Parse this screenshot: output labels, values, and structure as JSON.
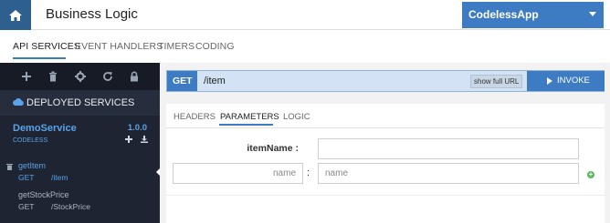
{
  "header": {
    "title": "Business Logic",
    "app_name": "CodelessApp"
  },
  "nav_tabs": [
    "API SERVICES",
    "EVENT HANDLERS",
    "TIMERS",
    "CODING"
  ],
  "sidebar": {
    "toolbar_icons": [
      "plus-icon",
      "trash-icon",
      "gear-icon",
      "refresh-icon",
      "lock-icon"
    ],
    "deployed_label": "DEPLOYED SERVICES",
    "service": {
      "name": "DemoService",
      "version": "1.0.0",
      "subtitle": "CODELESS"
    },
    "methods": [
      {
        "name": "getItem",
        "verb": "GET",
        "path": "/item"
      },
      {
        "name": "getStockPrice",
        "verb": "GET",
        "path": "/StockPrice"
      }
    ]
  },
  "request": {
    "method": "GET",
    "path": "/item",
    "show_url_label": "show full URL",
    "invoke_label": "INVOKE"
  },
  "sub_tabs": [
    "HEADERS",
    "PARAMETERS",
    "LOGIC"
  ],
  "params": {
    "field_label": "itemName :",
    "field_value": "",
    "name_placeholder": "name",
    "colon": ":",
    "value_placeholder": "name"
  },
  "colors": {
    "accent": "#3d7bc3",
    "sidebar_bg": "#1e2431",
    "link_blue": "#5aa3e8",
    "add_green": "#5cb85c"
  }
}
